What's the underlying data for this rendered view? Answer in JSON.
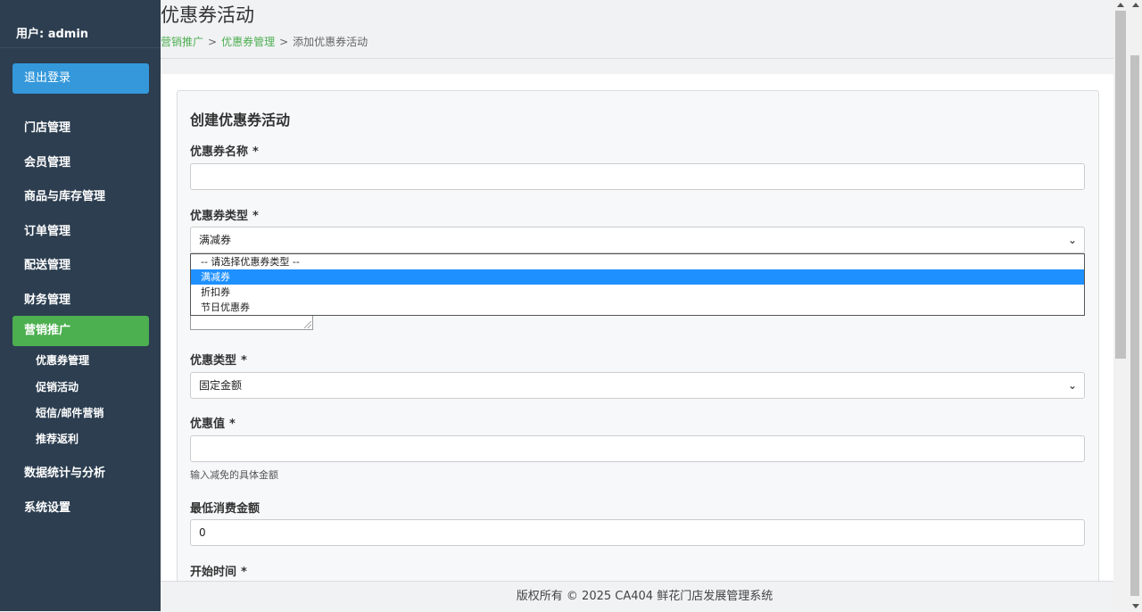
{
  "sidebar": {
    "user": "用户: admin",
    "logout": "退出登录",
    "items": [
      "门店管理",
      "会员管理",
      "商品与库存管理",
      "订单管理",
      "配送管理",
      "财务管理"
    ],
    "active": "营销推广",
    "sub_items": [
      "优惠券管理",
      "促销活动",
      "短信/邮件营销",
      "推荐返利"
    ],
    "items_after": [
      "数据统计与分析",
      "系统设置"
    ]
  },
  "header": {
    "title": "优惠券活动",
    "breadcrumb": [
      {
        "label": "营销推广",
        "link": true
      },
      {
        "label": "优惠券管理",
        "link": true
      },
      {
        "label": "添加优惠券活动",
        "link": false
      }
    ],
    "separator": ">"
  },
  "form": {
    "title": "创建优惠券活动",
    "required_mark": "*",
    "name_label": "优惠券名称",
    "name_value": "",
    "type_label": "优惠券类型",
    "type_value": "满减券",
    "type_options": [
      "-- 请选择优惠券类型 --",
      "满减券",
      "折扣券",
      "节日优惠券"
    ],
    "type_selected_index": 1,
    "discount_type_label": "优惠类型",
    "discount_type_value": "固定金额",
    "discount_value_label": "优惠值",
    "discount_value_value": "",
    "discount_value_help": "输入减免的具体金额",
    "min_spend_label": "最低消费金额",
    "min_spend_value": "0",
    "start_time_label": "开始时间"
  },
  "footer": {
    "text": "版权所有 © 2025 CA404 鲜花门店发展管理系统"
  },
  "colors": {
    "sidebar_bg": "#2c3e50",
    "logout_bg": "#3498db",
    "active_bg": "#4caf50",
    "link": "#4caf50",
    "selected_option": "#1e90ff"
  },
  "icons": {
    "select_chevron": "chevron-down-icon"
  }
}
